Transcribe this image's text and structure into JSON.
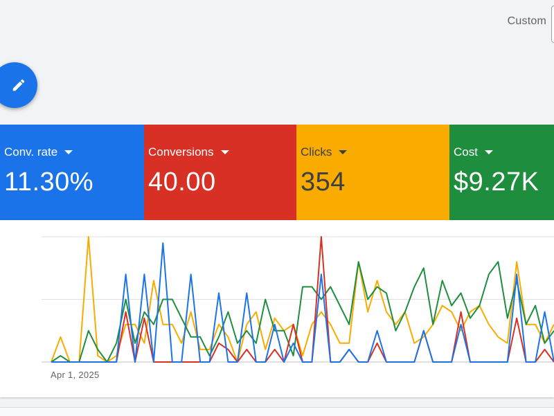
{
  "header": {
    "date_range_label": "Custom"
  },
  "fab": {
    "icon": "pencil-icon",
    "color": "#1a73e8"
  },
  "metrics": [
    {
      "label": "Conv. rate",
      "value": "11.30%",
      "color": "#1a73e8"
    },
    {
      "label": "Conversions",
      "value": "40.00",
      "color": "#d93025"
    },
    {
      "label": "Clicks",
      "value": "354",
      "color": "#f9ab00"
    },
    {
      "label": "Cost",
      "value": "$9.27K",
      "color": "#1e8e3e"
    }
  ],
  "chart": {
    "x_start_label": "Apr 1, 2025"
  },
  "chart_data": {
    "type": "line",
    "title": "",
    "xlabel": "",
    "ylabel": "",
    "x_start": "Apr 1, 2025",
    "ylim": [
      0,
      2
    ],
    "grid": true,
    "series": [
      {
        "metric": "Clicks",
        "color": "#f9ab00",
        "values": [
          0,
          0.4,
          0,
          0,
          2,
          0.1,
          0,
          0.1,
          0.6,
          0.6,
          0.3,
          1.3,
          0.6,
          0.6,
          0.3,
          0.8,
          0.2,
          0.2,
          0.6,
          0.4,
          0,
          0.6,
          0.8,
          0.2,
          0.7,
          0.5,
          0.6,
          0.1,
          0.6,
          0.8,
          0.6,
          0.3,
          0.3,
          1.6,
          0.8,
          1.3,
          0.8,
          0.6,
          0.8,
          0.3,
          0.4,
          0.6,
          0.9,
          0.8,
          0.5,
          0.8,
          0.9,
          0.6,
          0.4,
          0.3,
          1.6,
          0.6,
          0.6,
          0.3,
          0.6
        ]
      },
      {
        "metric": "Cost",
        "color": "#1e8e3e",
        "values": [
          0,
          0.1,
          0,
          0,
          0.5,
          0.2,
          0,
          0.3,
          1.0,
          0.3,
          0.8,
          0.6,
          1.0,
          1.0,
          0.7,
          0.4,
          0.4,
          0.1,
          0.4,
          0.8,
          0.3,
          0.5,
          0.3,
          1.0,
          0.5,
          0.5,
          0.1,
          1.2,
          1.2,
          1.0,
          1.2,
          0.9,
          0.6,
          1.6,
          1.0,
          1.2,
          1.1,
          0.5,
          0.8,
          1.2,
          1.5,
          0.6,
          1.3,
          0.9,
          1.1,
          0.7,
          0.9,
          1.4,
          1.6,
          0.7,
          1.3,
          0.6,
          0.9,
          0.3,
          0.5
        ]
      },
      {
        "metric": "Conversions",
        "color": "#d93025",
        "values": [
          0,
          0,
          0,
          0,
          0,
          0,
          0,
          0,
          0.8,
          0,
          0.7,
          0,
          0,
          0,
          0,
          0,
          0,
          0,
          0.3,
          0.2,
          0,
          0.2,
          0,
          0,
          0.2,
          0,
          0.6,
          0,
          0,
          2.0,
          0,
          0,
          0.2,
          0,
          0,
          0.3,
          0,
          0,
          0,
          0,
          0.5,
          0,
          0,
          0,
          0.8,
          0,
          0,
          0,
          0,
          0,
          0.7,
          0,
          0,
          0.2,
          0
        ]
      },
      {
        "metric": "Conv. rate",
        "color": "#1a73e8",
        "values": [
          0,
          0,
          0,
          0,
          0,
          0,
          0,
          0,
          1.4,
          0,
          1.4,
          0,
          1.9,
          0,
          0,
          1.4,
          0,
          0,
          1.1,
          0,
          0,
          1.1,
          0,
          0,
          0.6,
          0,
          0.3,
          0,
          0,
          1.4,
          0,
          0,
          0.2,
          0,
          0,
          0.5,
          0,
          0,
          0,
          0,
          0.5,
          0,
          0,
          0,
          0.6,
          0,
          0,
          0,
          0,
          0,
          1.4,
          0,
          0,
          0.8,
          0
        ]
      }
    ]
  }
}
